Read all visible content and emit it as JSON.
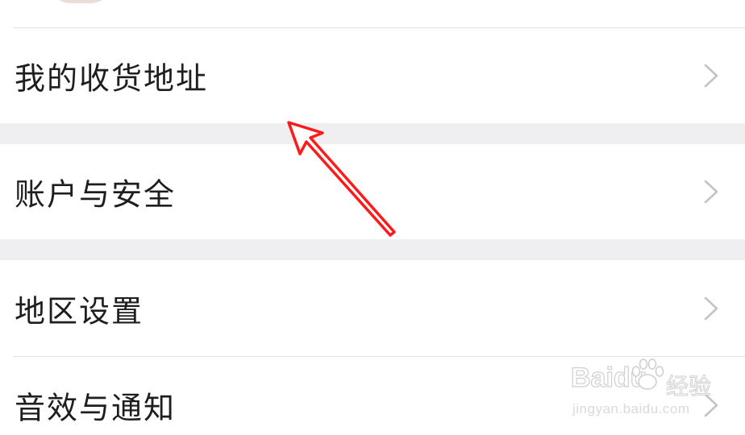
{
  "settings": {
    "items": [
      {
        "label": "我的收货地址"
      },
      {
        "label": "账户与安全"
      },
      {
        "label": "地区设置"
      },
      {
        "label": "音效与通知"
      }
    ]
  },
  "watermark": {
    "brand": "Baidu",
    "brand_cn": "经验",
    "url": "jingyan.baidu.com"
  },
  "colors": {
    "section_gap": "#efeff1",
    "divider": "#e3e3e3",
    "chevron": "#c4c4c4",
    "annotation_arrow": "#ff1a1a"
  }
}
